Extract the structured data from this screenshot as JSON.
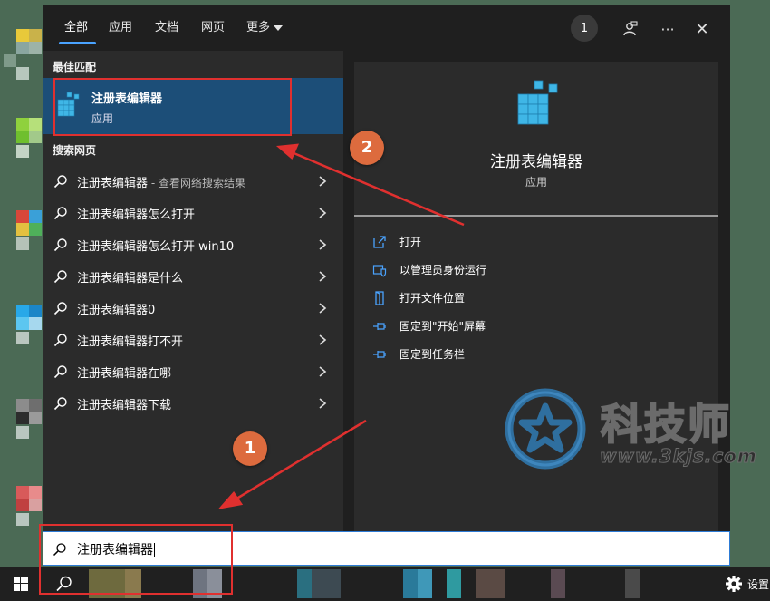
{
  "tabs": [
    {
      "label": "全部",
      "active": true
    },
    {
      "label": "应用"
    },
    {
      "label": "文档"
    },
    {
      "label": "网页"
    },
    {
      "label": "更多"
    }
  ],
  "top_actions": {
    "badge_count": "1",
    "feedback_icon": "feedback-icon",
    "more_icon": "ellipsis-icon",
    "close_icon": "close-icon",
    "more_label": "···",
    "close_label": "✕"
  },
  "best_match": {
    "section_label": "最佳匹配",
    "title": "注册表编辑器",
    "subtitle": "应用",
    "icon": "registry-editor-icon"
  },
  "web_search": {
    "section_label": "搜索网页",
    "items": [
      {
        "text": "注册表编辑器",
        "hint": " - 查看网络搜索结果"
      },
      {
        "text": "注册表编辑器怎么打开",
        "hint": ""
      },
      {
        "text": "注册表编辑器怎么打开 win10",
        "hint": ""
      },
      {
        "text": "注册表编辑器是什么",
        "hint": ""
      },
      {
        "text": "注册表编辑器0",
        "hint": ""
      },
      {
        "text": "注册表编辑器打不开",
        "hint": ""
      },
      {
        "text": "注册表编辑器在哪",
        "hint": ""
      },
      {
        "text": "注册表编辑器下载",
        "hint": ""
      }
    ]
  },
  "detail": {
    "title": "注册表编辑器",
    "subtitle": "应用",
    "actions": [
      {
        "label": "打开",
        "icon": "open-icon"
      },
      {
        "label": "以管理员身份运行",
        "icon": "shield-icon"
      },
      {
        "label": "打开文件位置",
        "icon": "folder-icon"
      },
      {
        "label": "固定到\"开始\"屏幕",
        "icon": "pin-icon"
      },
      {
        "label": "固定到任务栏",
        "icon": "pin-icon"
      }
    ]
  },
  "search_box": {
    "value": "注册表编辑器"
  },
  "taskbar": {
    "settings_label": "设置"
  },
  "watermark": {
    "text": "科技师",
    "url": "www.3kjs.com"
  },
  "annotations": {
    "step1": "1",
    "step2": "2"
  },
  "colors": {
    "accent": "#4aa3ff",
    "highlight": "#1c4e78",
    "annotation": "#e0302f",
    "step_circle": "#dd6b3e"
  }
}
